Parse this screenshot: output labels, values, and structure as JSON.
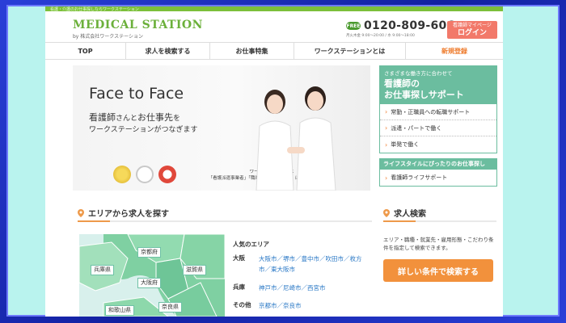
{
  "top_strip": "看護・介護のお仕事探しならワークステーション",
  "logo": {
    "main": "MEDICAL STATION",
    "sub": "by 株式会社ワークステーション"
  },
  "contact": {
    "free_label": "FREE",
    "phone": "0120-809-606",
    "hours": "月火木金 9:00〜20:00 / 水 9:00〜18:00"
  },
  "login": {
    "small": "看護師マイページ",
    "big": "ログイン"
  },
  "nav": [
    "TOP",
    "求人を検索する",
    "お仕事特集",
    "ワークステーションとは",
    "新規登録"
  ],
  "hero": {
    "title": "Face to Face",
    "line1_a": "看護師",
    "line1_b": "さんと",
    "line1_c": "お仕事先",
    "line1_d": "を",
    "line2": "ワークステーションがつなぎます",
    "note_line1": "ワークステーションは",
    "note_line2": "「看護派遣事業者」「職業紹介優良事業者」に認定されました。"
  },
  "right_panel": {
    "head_small": "さまざまな働き方に合わせて",
    "head_big_1": "看護師の",
    "head_big_2": "お仕事探しサポート",
    "items": [
      "常勤・正職員への転職サポート",
      "派遣・パートで働く",
      "単発で働く"
    ],
    "head2": "ライフスタイルにぴったりのお仕事探し",
    "items2": [
      "看護師ライフサポート"
    ]
  },
  "area": {
    "title": "エリアから求人を探す",
    "map_labels": [
      "京都府",
      "兵庫県",
      "滋賀県",
      "大阪府",
      "和歌山県",
      "奈良県"
    ],
    "popular_title": "人気のエリア",
    "rows": [
      {
        "pref": "大阪",
        "links": "大阪市／堺市／豊中市／吹田市／枚方市／東大阪市"
      },
      {
        "pref": "兵庫",
        "links": "神戸市／尼崎市／西宮市"
      },
      {
        "pref": "その他",
        "links": "京都市／奈良市"
      }
    ]
  },
  "search": {
    "title": "求人検索",
    "desc": "エリア・職種・就業先・雇用形態・こだわり条件を指定して検索できます。",
    "button": "詳しい条件で検索する"
  },
  "colors": {
    "brand_green": "#6bb03a",
    "teal": "#6bbd9f",
    "orange": "#f2913c",
    "login": "#f2796a"
  }
}
